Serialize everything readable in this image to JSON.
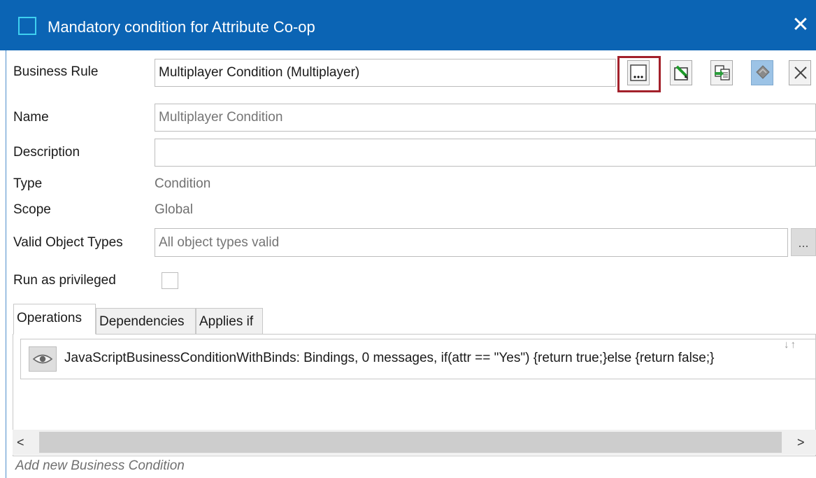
{
  "window": {
    "title": "Mandatory condition for Attribute Co-op",
    "close_glyph": "✕"
  },
  "form": {
    "business_rule": {
      "label": "Business Rule",
      "value": "Multiplayer Condition (Multiplayer)"
    },
    "name": {
      "label": "Name",
      "placeholder": "Multiplayer Condition"
    },
    "description": {
      "label": "Description",
      "value": ""
    },
    "type": {
      "label": "Type",
      "value": "Condition"
    },
    "scope": {
      "label": "Scope",
      "value": "Global"
    },
    "valid_object_types": {
      "label": "Valid Object Types",
      "placeholder": "All object types valid",
      "button": "..."
    },
    "run_as_privileged": {
      "label": "Run as privileged",
      "checked": false
    }
  },
  "toolbar": {
    "icons": [
      "browse-icon",
      "edit-icon",
      "copy-icon",
      "revert-icon",
      "clear-icon"
    ],
    "browse_glyph": "...",
    "highlight_color": "#a3212b"
  },
  "tabs": [
    {
      "label": "Operations",
      "active": true
    },
    {
      "label": "Dependencies",
      "active": false
    },
    {
      "label": "Applies if",
      "active": false
    }
  ],
  "operations": [
    {
      "text": "JavaScriptBusinessConditionWithBinds: Bindings, 0 messages, if(attr == \"Yes\") {return true;}else {return false;}",
      "icon": "eye-icon"
    }
  ],
  "sort_glyphs": "↓↑",
  "scrollbar": {
    "left_glyph": "<",
    "right_glyph": ">"
  },
  "add_link": "Add new Business Condition",
  "colors": {
    "titlebar": "#0b64b4",
    "icon_accent": "#3fd0f0"
  }
}
